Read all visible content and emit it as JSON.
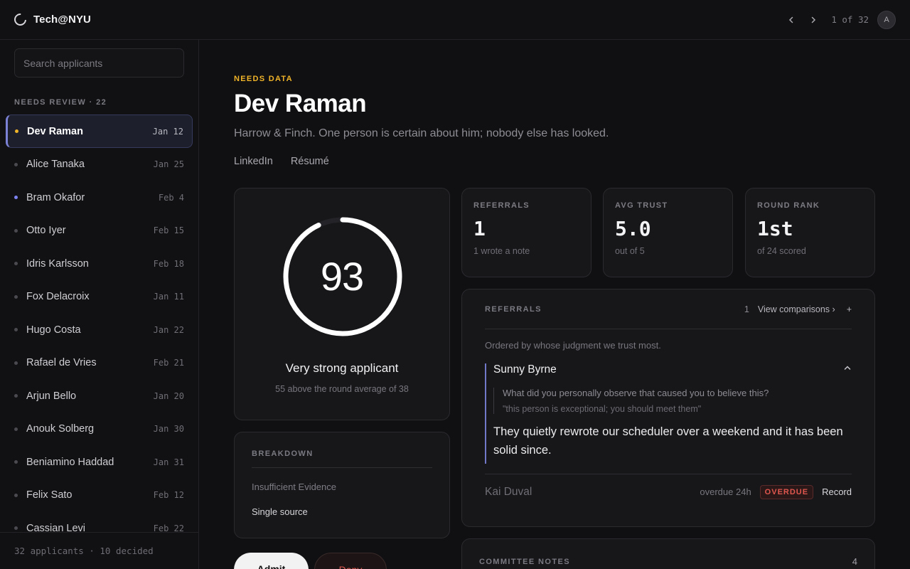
{
  "topbar": {
    "brand": "Tech@NYU",
    "prev_icon": "chevron-left-icon",
    "next_icon": "chevron-right-icon",
    "pager": "1 of 32",
    "avatar_initial": "A"
  },
  "sidebar": {
    "search_placeholder": "Search applicants",
    "section_label": "NEEDS REVIEW · 22",
    "items": [
      {
        "name": "Dev Raman",
        "date": "Jan 12",
        "dot": "amber"
      },
      {
        "name": "Alice Tanaka",
        "date": "Jan 25",
        "dot": "gray"
      },
      {
        "name": "Bram Okafor",
        "date": "Feb 4",
        "dot": "blue"
      },
      {
        "name": "Otto Iyer",
        "date": "Feb 15",
        "dot": "gray"
      },
      {
        "name": "Idris Karlsson",
        "date": "Feb 18",
        "dot": "gray"
      },
      {
        "name": "Fox Delacroix",
        "date": "Jan 11",
        "dot": "gray"
      },
      {
        "name": "Hugo Costa",
        "date": "Jan 22",
        "dot": "gray"
      },
      {
        "name": "Rafael de Vries",
        "date": "Feb 21",
        "dot": "gray"
      },
      {
        "name": "Arjun Bello",
        "date": "Jan 20",
        "dot": "gray"
      },
      {
        "name": "Anouk Solberg",
        "date": "Jan 30",
        "dot": "gray"
      },
      {
        "name": "Beniamino Haddad",
        "date": "Jan 31",
        "dot": "gray"
      },
      {
        "name": "Felix Sato",
        "date": "Feb 12",
        "dot": "gray"
      },
      {
        "name": "Cassian Levi",
        "date": "Feb 22",
        "dot": "gray"
      }
    ],
    "footer": "32 applicants · 10 decided"
  },
  "main": {
    "status": "NEEDS DATA",
    "name": "Dev Raman",
    "subtitle": "Harrow & Finch. One person is certain about him; nobody else has looked.",
    "links": [
      "LinkedIn",
      "Résumé"
    ],
    "score": {
      "value": "93",
      "fraction": 0.93,
      "verdict": "Very strong applicant",
      "sub": "55 above the round average of 38"
    },
    "stats": [
      {
        "label": "REFERRALS",
        "value": "1",
        "sub": "1 wrote a note"
      },
      {
        "label": "AVG TRUST",
        "value": "5.0",
        "sub": "out of 5"
      },
      {
        "label": "ROUND RANK",
        "value": "1st",
        "sub": "of 24 scored"
      }
    ],
    "breakdown": {
      "label": "BREAKDOWN",
      "row1": "Insufficient Evidence",
      "row2": "Single source"
    },
    "actions": {
      "admit": "Admit",
      "deny": "Deny"
    },
    "referrals": {
      "label": "REFERRALS",
      "count": "1",
      "view_link": "View comparisons ›",
      "add": "+",
      "ordering": "Ordered by whose judgment we trust most.",
      "entry": {
        "name": "Sunny Byrne",
        "question": "What did you personally observe that caused you to believe this?",
        "answer_short": "\"this person is exceptional; you should meet them\"",
        "answer": "They quietly rewrote our scheduler over a weekend and it has been solid since."
      },
      "pending": {
        "name": "Kai Duval",
        "overdue_text": "overdue 24h",
        "badge": "OVERDUE",
        "action": "Record"
      }
    },
    "notes": {
      "label": "COMMITTEE NOTES",
      "count": "4"
    }
  },
  "colors": {
    "accent_amber": "#f0b429",
    "accent_indigo": "#7c82d6",
    "danger": "#e0574f",
    "background": "#101012"
  }
}
